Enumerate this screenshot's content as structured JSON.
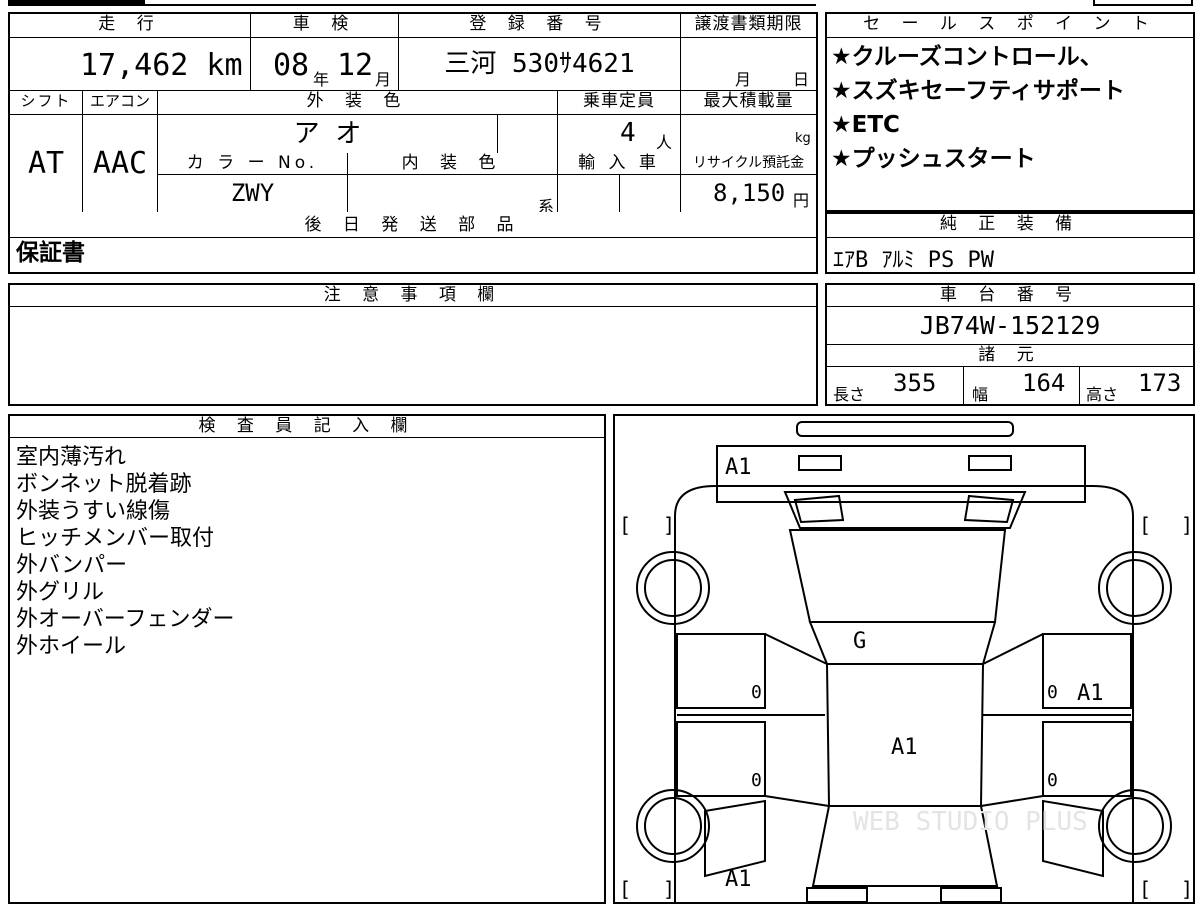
{
  "top_block": {
    "headers": {
      "mileage": "走 行",
      "inspection": "車 検",
      "registration": "登 録 番 号",
      "transfer_deadline": "譲渡書類期限"
    },
    "mileage_value": "17,462 km",
    "inspection_year": "08",
    "inspection_year_unit": "年",
    "inspection_month": "12",
    "inspection_month_unit": "月",
    "registration_value": "三河 530ｻ4621",
    "deadline_month_unit": "月",
    "deadline_day_unit": "日"
  },
  "spec_block": {
    "headers": {
      "shift": "シフト",
      "aircon": "エアコン",
      "exterior_color": "外 装 色",
      "capacity": "乗車定員",
      "max_load": "最大積載量",
      "color_no": "カ ラ ー No.",
      "interior_color": "内 装 色",
      "import": "輸 入 車",
      "recycle": "リサイクル預託金"
    },
    "shift_value": "AT",
    "aircon_value": "AAC",
    "exterior_color_value": "ア オ",
    "capacity_value": "4",
    "capacity_unit": "人",
    "max_load_unit": "kg",
    "color_no_value": "ZWY",
    "interior_color_unit": "系",
    "recycle_value": "8,150",
    "recycle_unit": "円"
  },
  "later_parts": {
    "header": "後 日 発 送 部 品",
    "value": "保証書"
  },
  "sales_points": {
    "header": "セ ー ル ス ポ イ ン ト",
    "items": [
      "★クルーズコントロール、",
      "★スズキセーフティサポート",
      "★ETC",
      "★プッシュスタート"
    ]
  },
  "genuine_equipment": {
    "header": "純 正 装 備",
    "value": "ｴｱB ｱﾙﾐ PS PW"
  },
  "notes": {
    "header": "注 意 事 項 欄"
  },
  "chassis": {
    "header": "車 台 番 号",
    "value": "JB74W-152129"
  },
  "dimensions": {
    "header": "諸 元",
    "length_label": "長さ",
    "length_value": "355",
    "width_label": "幅",
    "width_value": "164",
    "height_label": "高さ",
    "height_value": "173"
  },
  "inspector": {
    "header": "検 査 員 記 入 欄",
    "lines": [
      "室内薄汚れ",
      "ボンネット脱着跡",
      "外装うすい線傷",
      "ヒッチメンバー取付",
      "外バンパー",
      "外グリル",
      "外オーバーフェンダー",
      "外ホイール"
    ]
  },
  "diagram": {
    "marks": {
      "front": "A1",
      "windshield": "G",
      "roof": "A1",
      "right_front_door": "A1",
      "rear": "A1",
      "left_front_door": "0",
      "left_rear_door": "0",
      "right_front_door_num": "0",
      "right_rear_door_num": "0"
    },
    "bracket_open": "[",
    "bracket_close": "]",
    "watermark": "WEB STUDIO PLUS"
  }
}
